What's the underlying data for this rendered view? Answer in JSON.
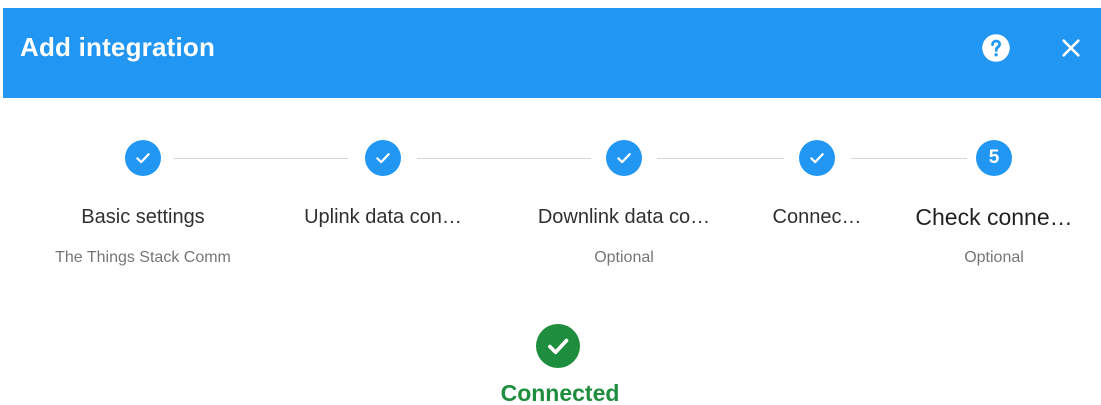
{
  "dialog": {
    "title": "Add integration",
    "help_icon": "help-circle-icon",
    "close_icon": "close-icon"
  },
  "stepper": {
    "steps": [
      {
        "label": "Basic settings",
        "sub": "The Things Stack Comm",
        "state": "completed"
      },
      {
        "label": "Uplink data con…",
        "sub": "",
        "state": "completed"
      },
      {
        "label": "Downlink data co…",
        "sub": "Optional",
        "state": "completed"
      },
      {
        "label": "Connec…",
        "sub": "",
        "state": "completed"
      },
      {
        "label": "Check conne…",
        "sub": "Optional",
        "state": "active",
        "number": "5"
      }
    ]
  },
  "status": {
    "text": "Connected",
    "icon": "check-circle-icon",
    "color": "#1e8e3e"
  },
  "colors": {
    "primary": "#2196f3",
    "success": "#1e8e3e",
    "connector": "#d6d6d6"
  }
}
